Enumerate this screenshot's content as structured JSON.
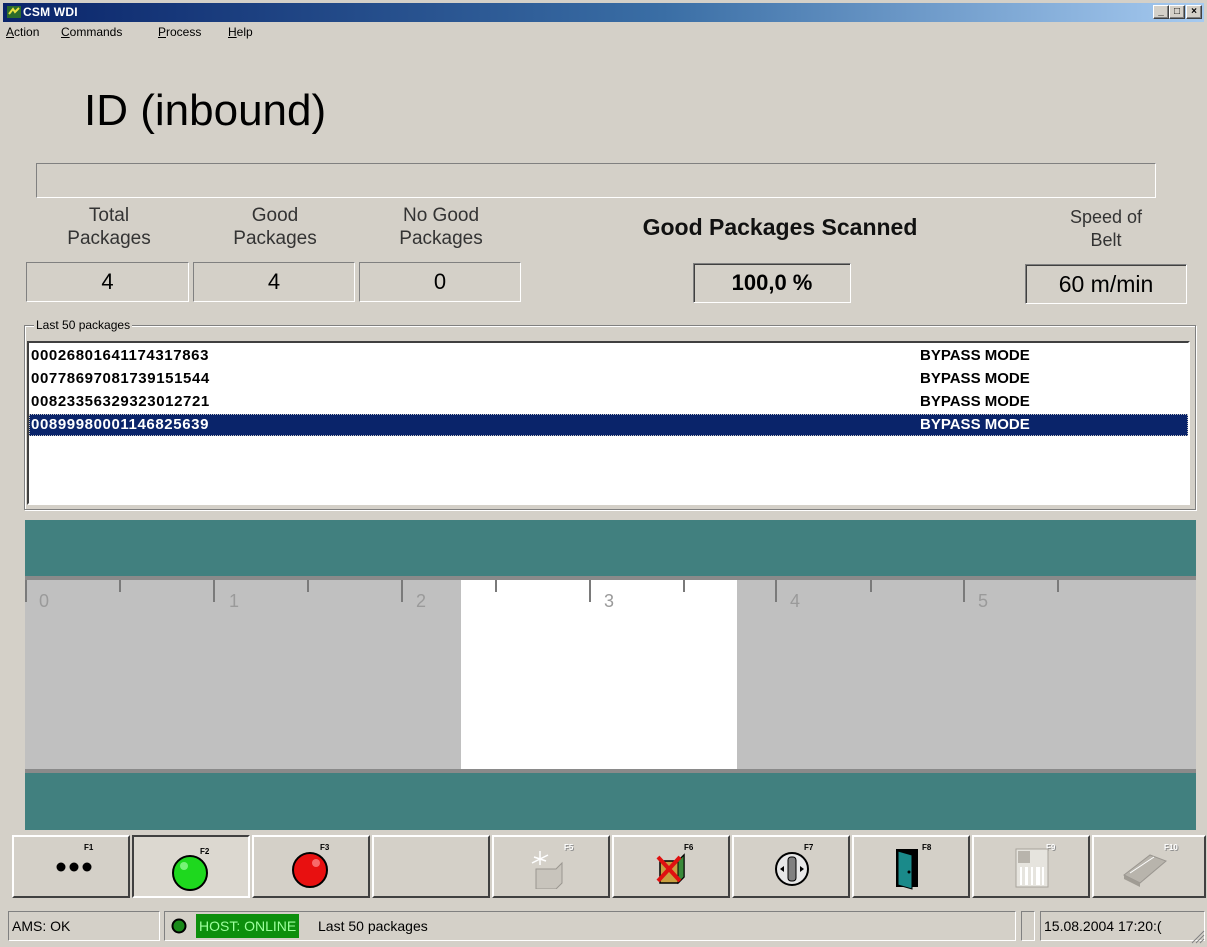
{
  "window": {
    "title": "CSM WDI",
    "buttons": {
      "minimize": "_",
      "maximize": "□",
      "close": "×"
    }
  },
  "menu": {
    "items": [
      {
        "label": "Action",
        "access_key": "A"
      },
      {
        "label": "Commands",
        "access_key": "C"
      },
      {
        "label": "Process",
        "access_key": "P"
      },
      {
        "label": "Help",
        "access_key": "H"
      }
    ]
  },
  "header": {
    "title": "ID (inbound)"
  },
  "stats": {
    "total": {
      "label_line1": "Total",
      "label_line2": "Packages",
      "value": "4"
    },
    "good": {
      "label_line1": "Good",
      "label_line2": "Packages",
      "value": "4"
    },
    "nogood": {
      "label_line1": "No Good",
      "label_line2": "Packages",
      "value": "0"
    },
    "good_scanned": {
      "label": "Good Packages Scanned",
      "value": "100,0 %"
    },
    "speed": {
      "label_line1": "Speed of",
      "label_line2": "Belt",
      "value": "60 m/min"
    }
  },
  "packages": {
    "group_label": "Last 50 packages",
    "rows": [
      {
        "code": "00026801641174317863",
        "status": "BYPASS MODE",
        "selected": false
      },
      {
        "code": "00778697081739151544",
        "status": "BYPASS MODE",
        "selected": false
      },
      {
        "code": "00823356329323012721",
        "status": "BYPASS MODE",
        "selected": false
      },
      {
        "code": "00899980001146825639",
        "status": "BYPASS MODE",
        "selected": true
      }
    ]
  },
  "conveyor": {
    "scale_labels": [
      "0",
      "1",
      "2",
      "3",
      "4",
      "5"
    ],
    "colors": {
      "belt": "#41807f",
      "surface": "#c0c0c0",
      "package": "#ffffff"
    }
  },
  "function_keys": [
    {
      "key": "F1",
      "icon": "more-dots-icon",
      "enabled": true
    },
    {
      "key": "F2",
      "icon": "green-start-icon",
      "enabled": true,
      "pressed": true
    },
    {
      "key": "F3",
      "icon": "red-stop-icon",
      "enabled": true
    },
    {
      "key": "",
      "icon": "",
      "enabled": true
    },
    {
      "key": "F5",
      "icon": "package-sparkle-icon",
      "enabled": false
    },
    {
      "key": "F6",
      "icon": "delete-package-icon",
      "enabled": true
    },
    {
      "key": "F7",
      "icon": "joystick-icon",
      "enabled": true
    },
    {
      "key": "F8",
      "icon": "exit-door-icon",
      "enabled": true
    },
    {
      "key": "F9",
      "icon": "barcode-grid-icon",
      "enabled": false
    },
    {
      "key": "F10",
      "icon": "book-icon",
      "enabled": false
    }
  ],
  "statusbar": {
    "ams": "AMS: OK",
    "host": "HOST: ONLINE",
    "message": "Last 50 packages",
    "datetime": "15.08.2004 17:20:("
  }
}
